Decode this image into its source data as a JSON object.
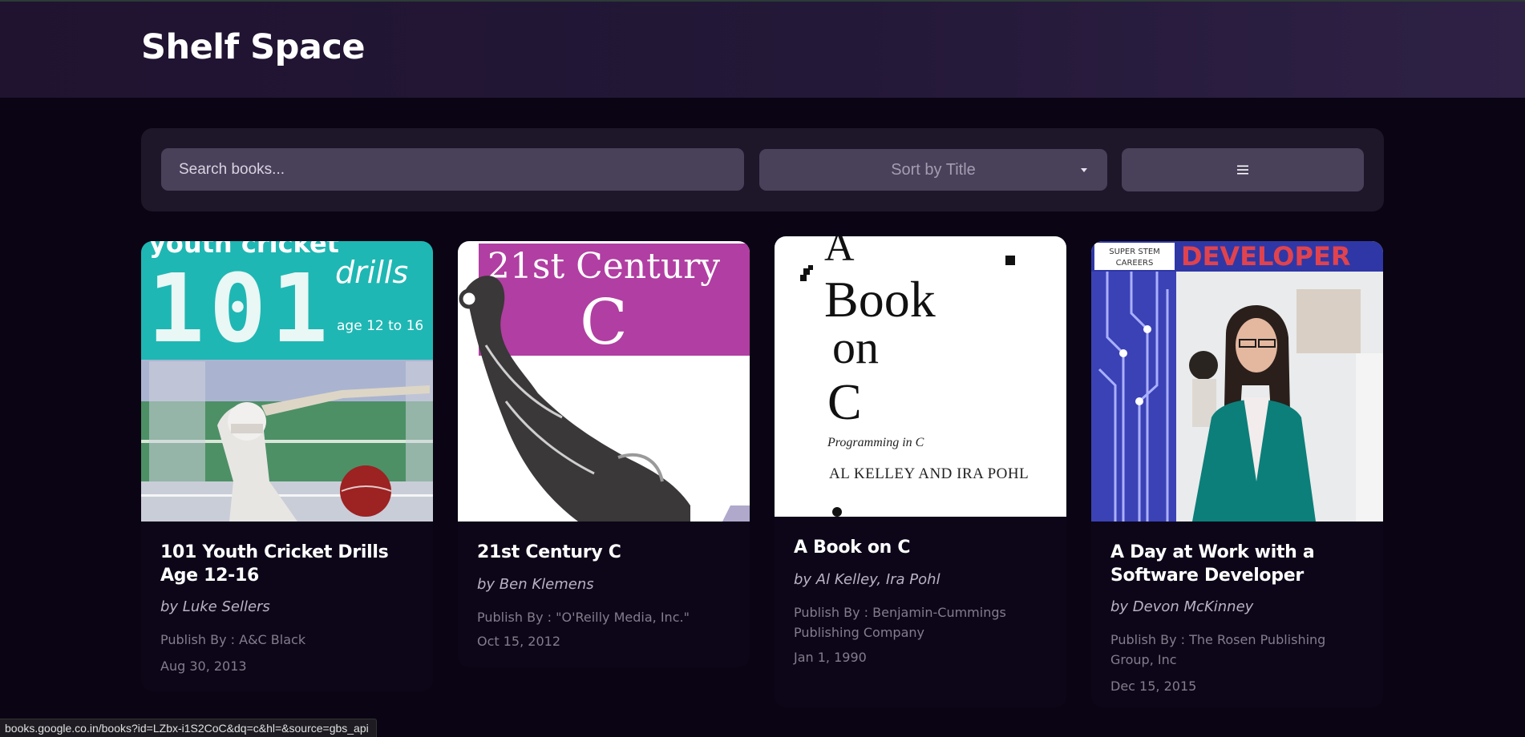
{
  "header": {
    "brand": "Shelf Space"
  },
  "toolbar": {
    "search_placeholder": "Search books...",
    "sort_label": "Sort by Title",
    "view_toggle_icon": "menu-icon"
  },
  "books": [
    {
      "title": "101 Youth Cricket Drills Age 12-16",
      "author": "by Luke Sellers",
      "publisher": "Publish By : A&C Black",
      "date": "Aug 30, 2013",
      "cover": {
        "line1": "youth cricket",
        "line2": "101",
        "line3": "drills",
        "line4": "age 12 to 16"
      }
    },
    {
      "title": "21st Century C",
      "author": "by Ben Klemens",
      "publisher": "Publish By : \"O'Reilly Media, Inc.\"",
      "date": "Oct 15, 2012",
      "cover": {
        "line1": "21st Century",
        "line2": "C"
      }
    },
    {
      "title": "A Book on C",
      "author": "by Al Kelley, Ira Pohl",
      "publisher": "Publish By : Benjamin-Cummings Publishing Company",
      "date": "Jan 1, 1990",
      "cover": {
        "line1": "A",
        "line2": "Book",
        "line3": "on",
        "line4": "C",
        "line5": "Programming in C",
        "line6": "AL KELLEY AND IRA POHL"
      }
    },
    {
      "title": "A Day at Work with a Software Developer",
      "author": "by Devon McKinney",
      "publisher": "Publish By : The Rosen Publishing Group, Inc",
      "date": "Dec 15, 2015",
      "cover": {
        "line1": "SUPER STEM",
        "line2": "CAREERS",
        "line3": "DEVELOPER"
      }
    }
  ],
  "status_bar": {
    "url": "books.google.co.in/books?id=LZbx-i1S2CoC&dq=c&hl=&source=gbs_api"
  }
}
